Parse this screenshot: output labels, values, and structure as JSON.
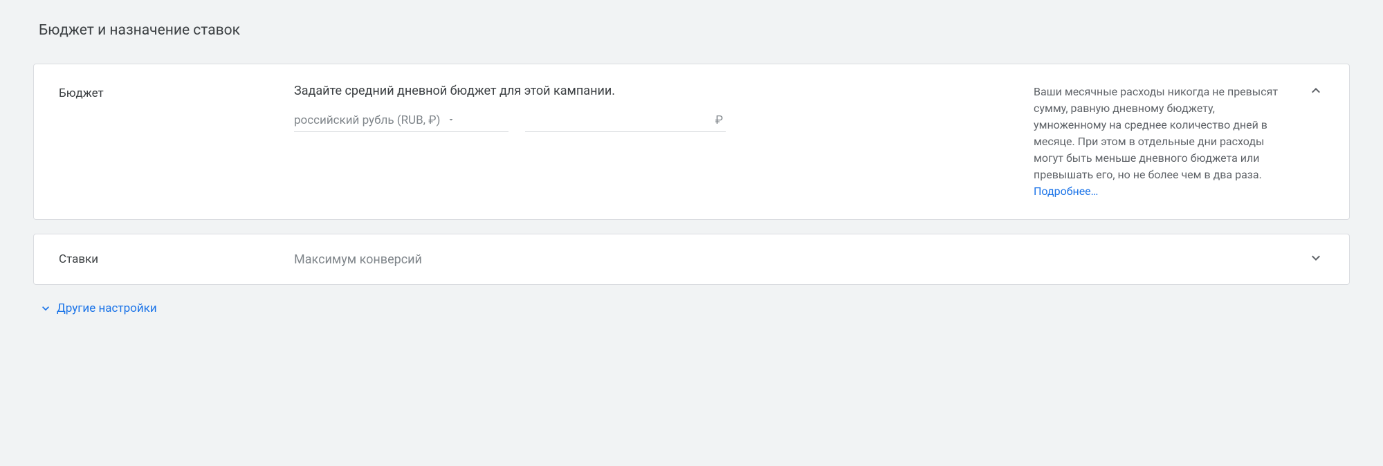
{
  "section": {
    "title": "Бюджет и назначение ставок"
  },
  "budget": {
    "label": "Бюджет",
    "heading": "Задайте средний дневной бюджет для этой кампании.",
    "currency_label": "российский рубль (RUB, ₽)",
    "currency_symbol": "₽",
    "amount_value": "",
    "info_text": "Ваши месячные расходы никогда не превысят сумму, равную дневному бюджету, умноженному на среднее количество дней в месяце. При этом в отдельные дни расходы могут быть меньше дневного бюджета или превышать его, но не более чем в два раза.",
    "info_link": "Подробнее…"
  },
  "bids": {
    "label": "Ставки",
    "value": "Максимум конверсий"
  },
  "more_settings": {
    "label": "Другие настройки"
  }
}
